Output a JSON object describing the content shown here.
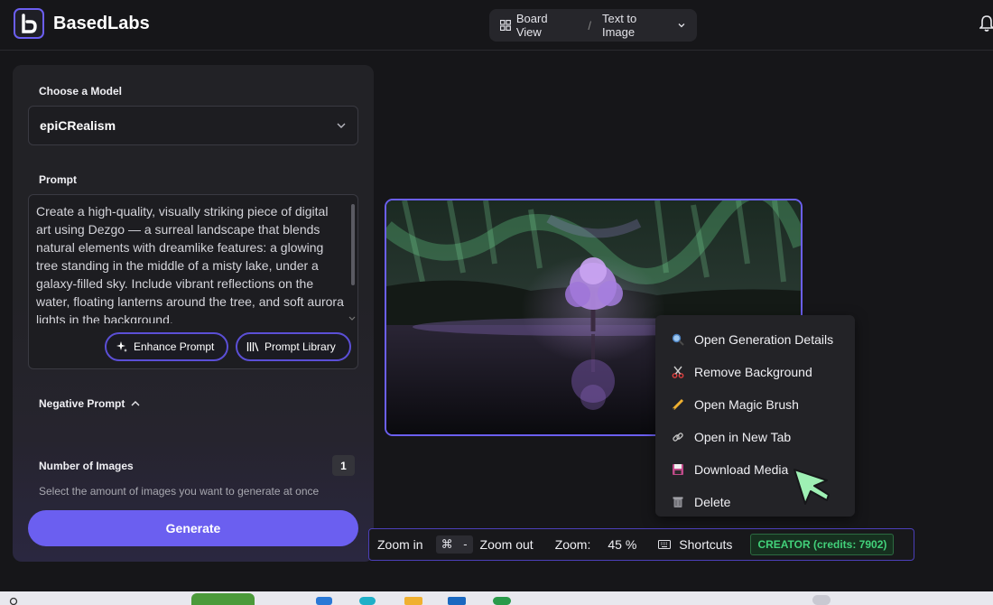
{
  "app": {
    "name": "BasedLabs"
  },
  "nav": {
    "board_view": "Board View",
    "separator": "/",
    "mode": "Text to Image"
  },
  "panel": {
    "model_label": "Choose a Model",
    "model_value": "epiCRealism",
    "prompt_label": "Prompt",
    "prompt_text": "Create a high-quality, visually striking piece of digital art using Dezgo — a surreal landscape that blends natural elements with dreamlike features: a glowing tree standing in the middle of a misty lake, under a galaxy-filled sky. Include vibrant reflections on the water, floating lanterns around the tree, and soft aurora lights in the background.",
    "enhance_prompt": "Enhance Prompt",
    "prompt_library": "Prompt Library",
    "negative_prompt_label": "Negative Prompt",
    "num_images_label": "Number of Images",
    "num_images_value": "1",
    "num_images_helper": "Select the amount of images you want to generate at once",
    "generate": "Generate"
  },
  "context_menu": {
    "items": [
      {
        "label": "Open Generation Details",
        "icon": "magnifier-icon"
      },
      {
        "label": "Remove Background",
        "icon": "scissors-icon"
      },
      {
        "label": "Open Magic Brush",
        "icon": "pencil-icon"
      },
      {
        "label": "Open in New Tab",
        "icon": "link-icon"
      },
      {
        "label": "Download Media",
        "icon": "floppy-disk-icon"
      },
      {
        "label": "Delete",
        "icon": "trash-icon"
      }
    ]
  },
  "toolbar": {
    "zoom_in": "Zoom in",
    "cmd_key": "⌘",
    "minus_key": "-",
    "zoom_out": "Zoom out",
    "zoom_label": "Zoom:",
    "zoom_value": "45 %",
    "shortcuts": "Shortcuts",
    "creator_badge": "CREATOR (credits: 7902)"
  },
  "colors": {
    "accent": "#6b5ff0",
    "background": "#161619",
    "panel": "#222226",
    "creator_green": "#42d17a",
    "cursor_green": "#9ef0b4"
  }
}
